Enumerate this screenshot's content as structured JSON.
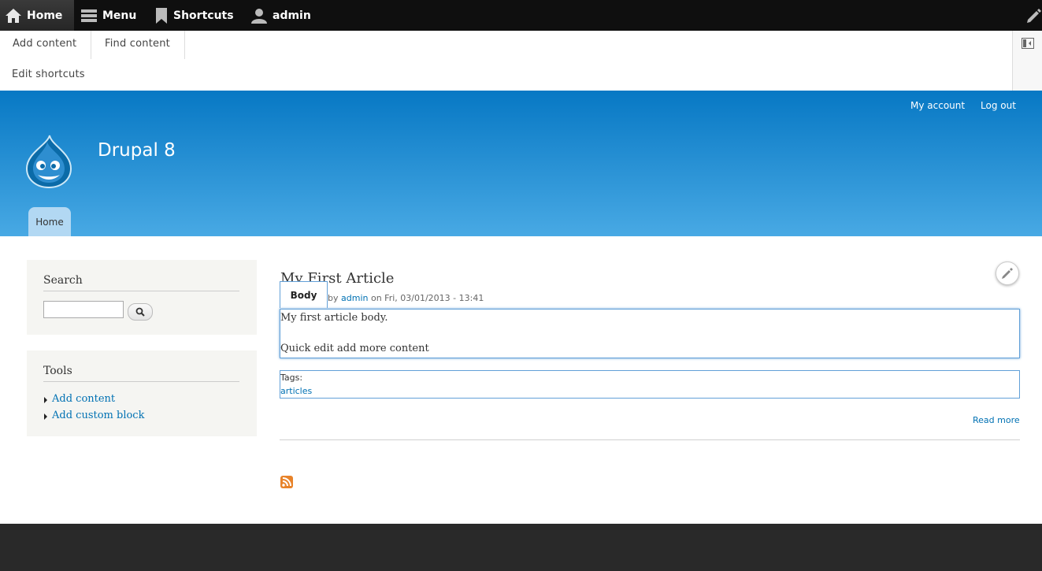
{
  "toolbar": {
    "home": "Home",
    "menu": "Menu",
    "shortcuts": "Shortcuts",
    "user": "admin"
  },
  "tray": {
    "add_content": "Add content",
    "find_content": "Find content",
    "edit_shortcuts": "Edit shortcuts"
  },
  "header": {
    "my_account": "My account",
    "log_out": "Log out",
    "site_name": "Drupal 8",
    "nav_home": "Home"
  },
  "sidebar": {
    "search_title": "Search",
    "tools_title": "Tools",
    "tools": [
      "Add content",
      "Add custom block"
    ]
  },
  "article": {
    "title": "My First Article",
    "quick_edit_label": "Body",
    "meta_prefix": "by",
    "author": "admin",
    "meta_date": "on Fri, 03/01/2013 - 13:41",
    "body_line1": "My first article body.",
    "body_line2": "Quick edit add more content",
    "tags_label": "Tags:",
    "tag": "articles",
    "read_more": "Read more"
  },
  "colors": {
    "toolbar_bg": "#0f0f0f",
    "header_top": "#0778c4",
    "header_bottom": "#48a9e4",
    "link": "#0071b3",
    "quick_edit_outline": "#62a0d8",
    "footer_bg": "#292929"
  }
}
